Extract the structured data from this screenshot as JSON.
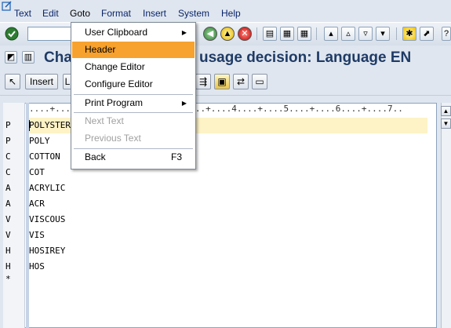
{
  "menubar": {
    "items": [
      "Text",
      "Edit",
      "Goto",
      "Format",
      "Insert",
      "System",
      "Help"
    ]
  },
  "title": {
    "left": "Cha",
    "right": "usage decision: Language EN"
  },
  "app_toolbar": {
    "insert_label": "Insert",
    "second_label": "L"
  },
  "goto_menu": {
    "items": [
      {
        "label": "User Clipboard",
        "submenu": true,
        "enabled": true
      },
      {
        "label": "Header",
        "enabled": true,
        "highlighted": true
      },
      {
        "label": "Change Editor",
        "enabled": true
      },
      {
        "label": "Configure Editor",
        "enabled": true
      },
      {
        "label": "Print Program",
        "submenu": true,
        "enabled": true
      },
      {
        "label": "Next Text",
        "enabled": false
      },
      {
        "label": "Previous Text",
        "enabled": false
      },
      {
        "label": "Back",
        "shortcut": "F3",
        "enabled": true
      }
    ],
    "submenu_arrow": "▶"
  },
  "editor": {
    "ruler": "....+....1....+....2....+....3....+....4....+....5....+....6....+....7..",
    "rows": [
      {
        "format": "P",
        "text": "POLYSTER"
      },
      {
        "format": "P",
        "text": "POLY"
      },
      {
        "format": "C",
        "text": "COTTON"
      },
      {
        "format": "C",
        "text": "COT"
      },
      {
        "format": "A",
        "text": "ACRYLIC"
      },
      {
        "format": "A",
        "text": "ACR"
      },
      {
        "format": "V",
        "text": "VISCOUS"
      },
      {
        "format": "V",
        "text": "VIS"
      },
      {
        "format": "H",
        "text": "HOSIREY"
      },
      {
        "format": "H",
        "text": "HOS"
      },
      {
        "format": "*",
        "text": ""
      }
    ]
  },
  "scroll": {
    "up": "▲",
    "down": "▼"
  },
  "colors": {
    "menu_highlight": "#f7a12e",
    "title_text": "#1f3b66",
    "current_line": "#fdf3c7"
  }
}
